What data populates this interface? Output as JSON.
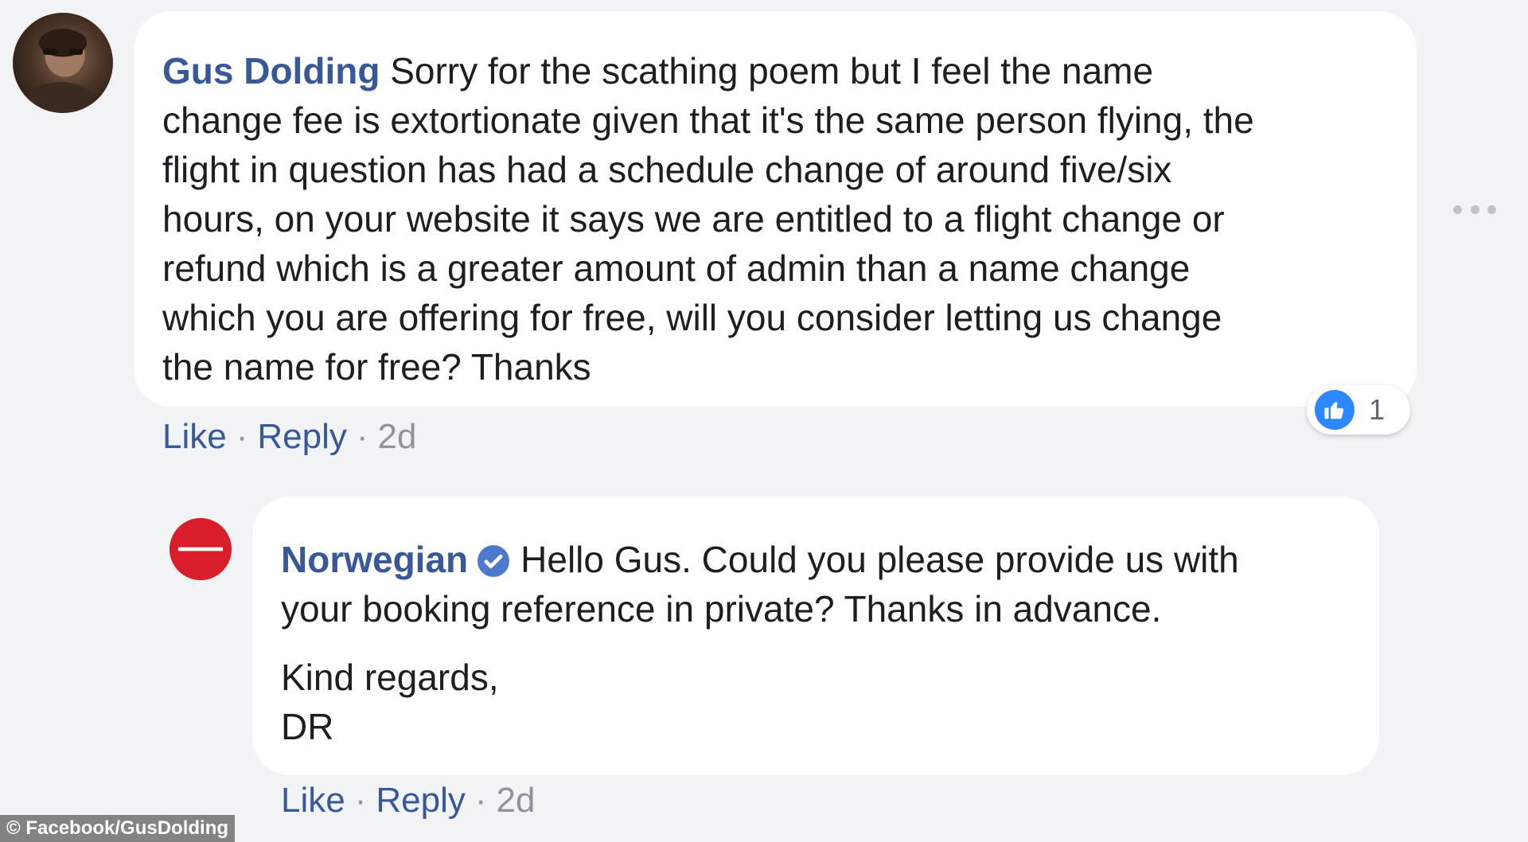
{
  "colors": {
    "background": "#f2f3f5",
    "bubble": "#ffffff",
    "author_link": "#385898",
    "action_link": "#385898",
    "meta_text": "#8d949e",
    "like_badge": "#2d88ff",
    "norwegian_brand": "#d81e2a"
  },
  "comment": {
    "author": "Gus Dolding",
    "avatar_icon": "user-photo-avatar",
    "lines": [
      "Sorry for the scathing poem but I feel the name",
      "change fee is extortionate given that it's the same person flying, the",
      "flight in question has had a schedule change of around five/six",
      "hours, on your website it says we are entitled to a flight change or",
      "refund which is a greater amount of admin than a name change",
      "which you are offering for free, will you consider letting us change",
      "the name for free? Thanks"
    ],
    "actions": {
      "like": "Like",
      "reply": "Reply",
      "time": "2d",
      "separator": "·"
    },
    "reaction": {
      "icon": "thumbs-up-icon",
      "count": "1"
    },
    "more_icon": "more-options-icon"
  },
  "reply": {
    "author": "Norwegian",
    "avatar_icon": "norwegian-logo-avatar",
    "verified_icon": "verified-badge-icon",
    "lines": [
      "Hello Gus. Could you please provide us with",
      "your booking reference in private? Thanks in advance."
    ],
    "sign_off": [
      "Kind regards,",
      "DR"
    ],
    "actions": {
      "like": "Like",
      "reply": "Reply",
      "time": "2d",
      "separator": "·"
    }
  },
  "watermark": "© Facebook/GusDolding"
}
